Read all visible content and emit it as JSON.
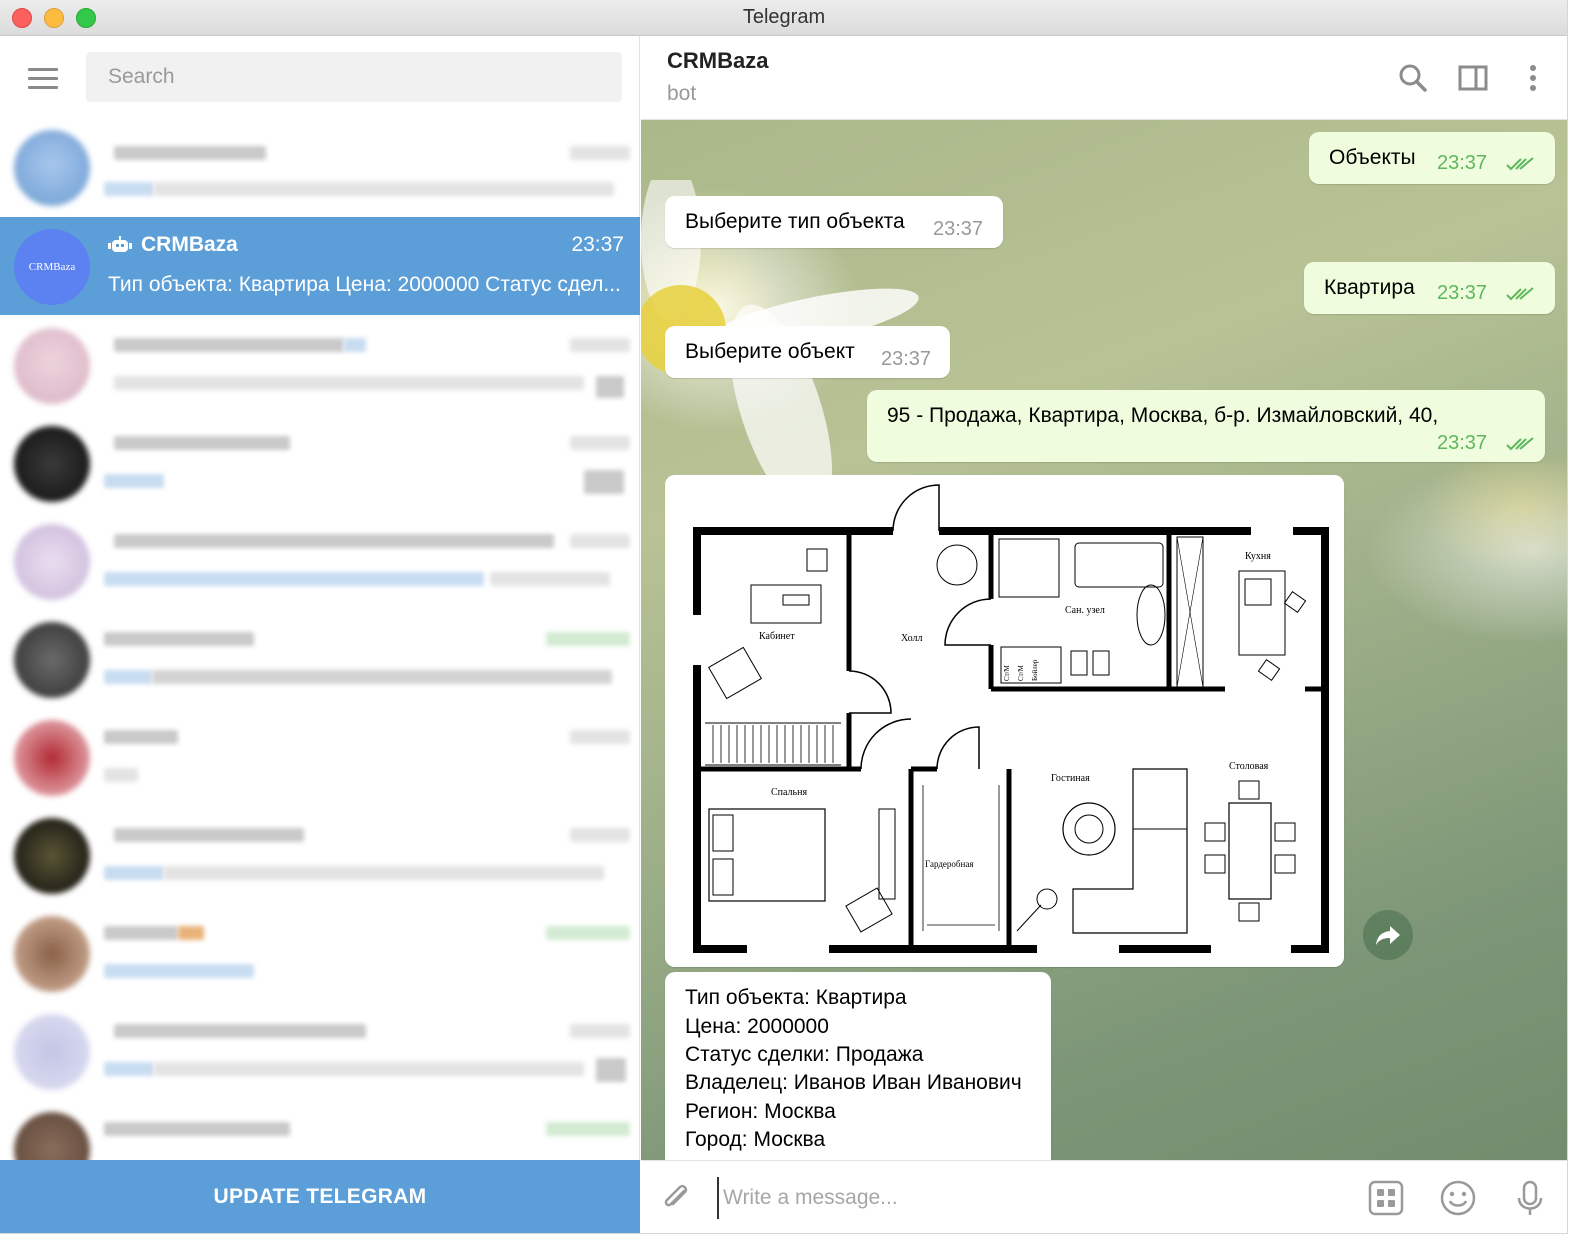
{
  "window": {
    "title": "Telegram"
  },
  "sidebar": {
    "search_placeholder": "Search",
    "active_chat": {
      "avatar_text": "CRMBaza",
      "name": "CRMBaza",
      "time": "23:37",
      "preview": "Тип объекта: Квартира Цена: 2000000 Статус сдел..."
    },
    "update_button": "UPDATE TELEGRAM"
  },
  "chat": {
    "name": "CRMBaza",
    "status": "bot",
    "messages": [
      {
        "dir": "out",
        "text": "Объекты",
        "time": "23:37"
      },
      {
        "dir": "in",
        "text": "Выберите тип объекта",
        "time": "23:37"
      },
      {
        "dir": "out",
        "text": "Квартира",
        "time": "23:37"
      },
      {
        "dir": "in",
        "text": "Выберите объект",
        "time": "23:37"
      },
      {
        "dir": "out",
        "text": "95 - Продажа, Квартира, Москва, б-р. Измайловский, 40,",
        "time": "23:37"
      }
    ],
    "floorplan": {
      "rooms": {
        "kitchen": "Кухня",
        "bathroom": "Сан. узел",
        "study": "Кабинет",
        "hall": "Холл",
        "bedroom": "Спальня",
        "wardrobe": "Гардеробная",
        "living": "Гостиная",
        "dining": "Столовая",
        "appliance1": "Ст/М",
        "appliance2": "Ст/М",
        "boiler": "Бойлер"
      }
    },
    "info": [
      "Тип объекта: Квартира",
      "Цена: 2000000",
      "Статус сделки: Продажа",
      "Владелец: Иванов Иван Иванович",
      "Регион: Москва",
      "Город: Москва"
    ],
    "composer_placeholder": "Write a message..."
  },
  "colors": {
    "accent": "#5c9fd8",
    "out_bubble": "#effdde",
    "read_ticks": "#5eb75c"
  },
  "icons": [
    "hamburger-icon",
    "bot-icon",
    "search-icon",
    "sidebar-toggle-icon",
    "more-icon",
    "share-icon",
    "attach-icon",
    "bot-keyboard-icon",
    "emoji-icon",
    "microphone-icon",
    "double-check-icon"
  ]
}
